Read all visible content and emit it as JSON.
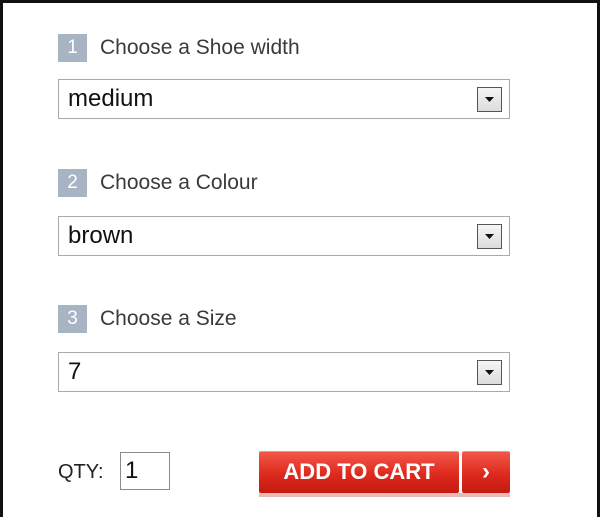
{
  "steps": [
    {
      "number": "1",
      "title": "Choose a Shoe width",
      "selected": "medium"
    },
    {
      "number": "2",
      "title": "Choose a Colour",
      "selected": "brown"
    },
    {
      "number": "3",
      "title": "Choose a Size",
      "selected": "7"
    }
  ],
  "qty": {
    "label": "QTY:",
    "value": "1"
  },
  "cart": {
    "label": "ADD TO CART",
    "chevron": "›"
  },
  "colors": {
    "step_badge": "#a8b4c3",
    "cart_red": "#df2a1e"
  }
}
